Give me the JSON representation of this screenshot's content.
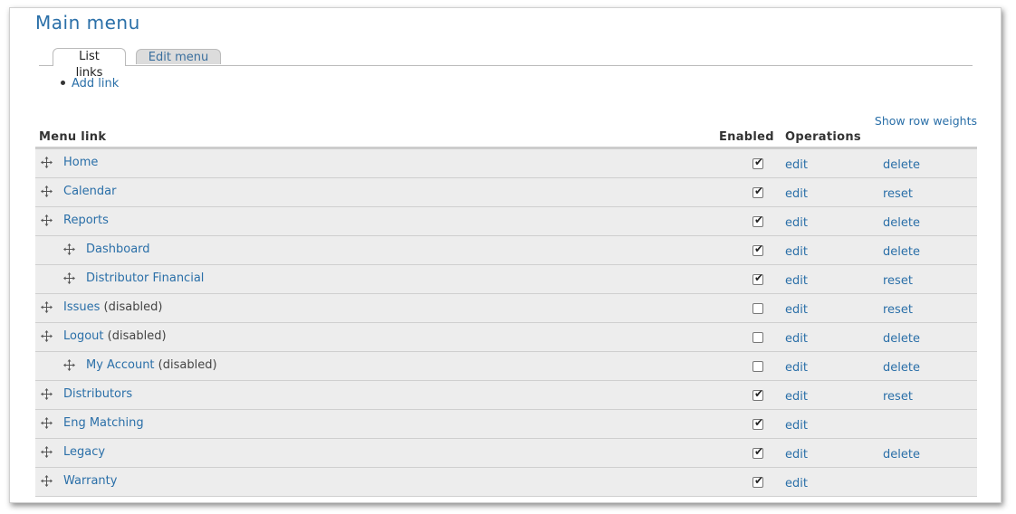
{
  "page": {
    "title": "Main menu"
  },
  "tabs": [
    {
      "label": "List links",
      "active": true
    },
    {
      "label": "Edit menu",
      "active": false
    }
  ],
  "actions": {
    "add_link": "Add link"
  },
  "table": {
    "show_row_weights": "Show row weights",
    "headers": {
      "menu_link": "Menu link",
      "enabled": "Enabled",
      "operations": "Operations"
    },
    "rows": [
      {
        "label": "Home",
        "disabled_note": "",
        "indent": 0,
        "enabled": true,
        "op_edit": "edit",
        "op_other": "delete"
      },
      {
        "label": "Calendar",
        "disabled_note": "",
        "indent": 0,
        "enabled": true,
        "op_edit": "edit",
        "op_other": "reset"
      },
      {
        "label": "Reports",
        "disabled_note": "",
        "indent": 0,
        "enabled": true,
        "op_edit": "edit",
        "op_other": "delete"
      },
      {
        "label": "Dashboard",
        "disabled_note": "",
        "indent": 1,
        "enabled": true,
        "op_edit": "edit",
        "op_other": "delete"
      },
      {
        "label": "Distributor Financial",
        "disabled_note": "",
        "indent": 1,
        "enabled": true,
        "op_edit": "edit",
        "op_other": "reset"
      },
      {
        "label": "Issues",
        "disabled_note": "(disabled)",
        "indent": 0,
        "enabled": false,
        "op_edit": "edit",
        "op_other": "reset"
      },
      {
        "label": "Logout",
        "disabled_note": "(disabled)",
        "indent": 0,
        "enabled": false,
        "op_edit": "edit",
        "op_other": "delete"
      },
      {
        "label": "My Account",
        "disabled_note": "(disabled)",
        "indent": 1,
        "enabled": false,
        "op_edit": "edit",
        "op_other": "delete"
      },
      {
        "label": "Distributors",
        "disabled_note": "",
        "indent": 0,
        "enabled": true,
        "op_edit": "edit",
        "op_other": "reset"
      },
      {
        "label": "Eng Matching",
        "disabled_note": "",
        "indent": 0,
        "enabled": true,
        "op_edit": "edit",
        "op_other": ""
      },
      {
        "label": "Legacy",
        "disabled_note": "",
        "indent": 0,
        "enabled": true,
        "op_edit": "edit",
        "op_other": "delete"
      },
      {
        "label": "Warranty",
        "disabled_note": "",
        "indent": 0,
        "enabled": true,
        "op_edit": "edit",
        "op_other": ""
      }
    ]
  },
  "colors": {
    "link": "#2a6fa8",
    "row_bg": "#ededed",
    "tab_inactive_bg": "#dcdcdc"
  },
  "icons": {
    "drag_handle": "drag-handle-icon",
    "checkbox_check": "check-icon"
  }
}
